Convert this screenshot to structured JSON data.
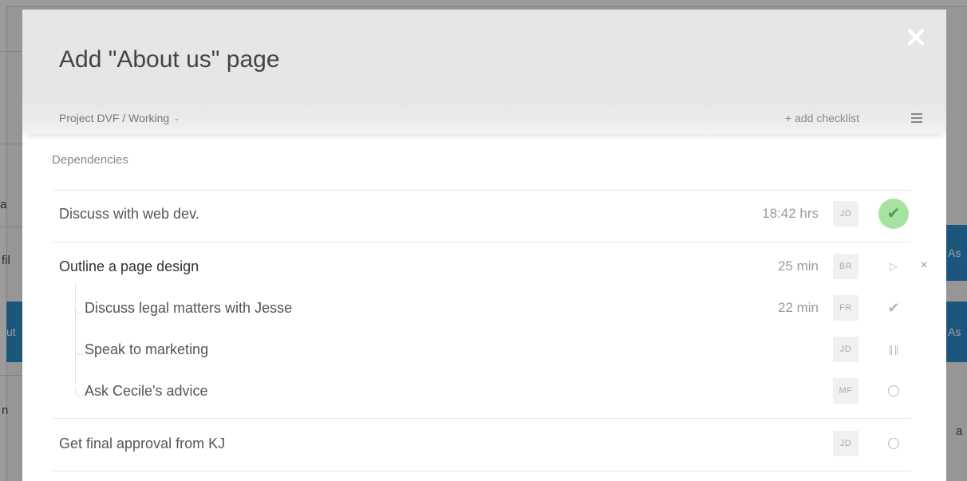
{
  "background": {
    "snippets": [
      "a",
      "fil",
      "ut",
      "n",
      "As",
      "As",
      "a"
    ]
  },
  "modal": {
    "title": "Add \"About us\" page",
    "close_icon": "close-icon",
    "breadcrumb": "Project DVF / Working",
    "add_checklist": "+ add checklist",
    "menu_icon": "hamburger-menu-icon",
    "section_label": "Dependencies",
    "colors": {
      "header_bg": "#e6e6e6",
      "done_green": "#a6e3a0",
      "text": "#555555"
    }
  },
  "tasks": [
    {
      "name": "Discuss with web dev.",
      "time": "18:42 hrs",
      "assignee": "JD",
      "status": "done",
      "status_icon": "check-circle-icon"
    },
    {
      "name": "Outline a page design",
      "time": "25 min",
      "assignee": "BR",
      "status": "play",
      "status_icon": "play-icon",
      "remove_icon": "×",
      "subtasks": [
        {
          "name": "Discuss legal matters with Jesse",
          "time": "22 min",
          "assignee": "FR",
          "status": "checked",
          "status_icon": "check-icon"
        },
        {
          "name": "Speak to marketing",
          "time": "",
          "assignee": "JD",
          "status": "paused",
          "status_icon": "pause-icon"
        },
        {
          "name": "Ask Cecile's advice",
          "time": "",
          "assignee": "MF",
          "status": "todo",
          "status_icon": "circle-icon"
        }
      ]
    },
    {
      "name": "Get final approval from KJ",
      "time": "",
      "assignee": "JD",
      "status": "todo",
      "status_icon": "circle-icon"
    }
  ],
  "icons": {
    "close": "✕",
    "check": "✔",
    "play": "▷",
    "remove": "×",
    "chevron": "⌄"
  }
}
